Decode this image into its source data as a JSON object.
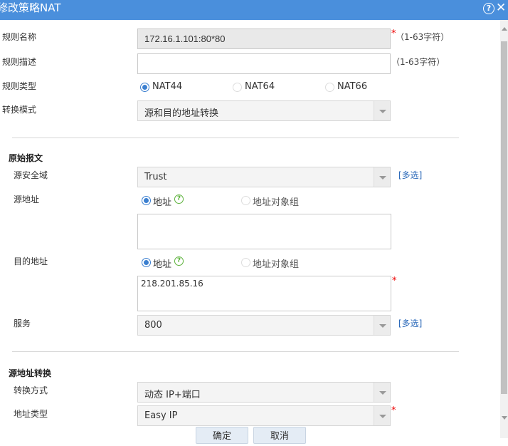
{
  "dialog": {
    "title": "修改策略NAT",
    "help_icon": "?",
    "close_icon": "✕"
  },
  "rule": {
    "name_label": "规则名称",
    "name_value": "172.16.1.101:80*80",
    "name_required": "*",
    "name_hint": "（1-63字符）",
    "desc_label": "规则描述",
    "desc_value": "",
    "desc_hint": "（1-63字符）",
    "type_label": "规则类型",
    "type_options": [
      "NAT44",
      "NAT64",
      "NAT66"
    ],
    "type_selected": "NAT44",
    "mode_label": "转换模式",
    "mode_value": "源和目的地址转换"
  },
  "original_packet": {
    "section_title": "原始报文",
    "src_zone_label": "源安全域",
    "src_zone_value": "Trust",
    "src_zone_multi": "[多选]",
    "src_addr_label": "源地址",
    "src_addr_options": [
      "地址",
      "地址对象组"
    ],
    "src_addr_selected": "地址",
    "src_addr_value": "",
    "dst_addr_label": "目的地址",
    "dst_addr_options": [
      "地址",
      "地址对象组"
    ],
    "dst_addr_selected": "地址",
    "dst_addr_value": "218.201.85.16",
    "dst_addr_required": "*",
    "service_label": "服务",
    "service_value": "800",
    "service_multi": "[多选]"
  },
  "src_translation": {
    "section_title": "源地址转换",
    "method_label": "转换方式",
    "method_value": "动态 IP+端口",
    "addr_type_label": "地址类型",
    "addr_type_value": "Easy IP",
    "addr_type_required": "*"
  },
  "buttons": {
    "ok": "确定",
    "cancel": "取消"
  },
  "colors": {
    "titlebar": "#4a8fdc",
    "radio_selected": "#3b7fd0",
    "link": "#2766b8",
    "required": "#ee0000",
    "help_icon": "#5cb23b"
  }
}
